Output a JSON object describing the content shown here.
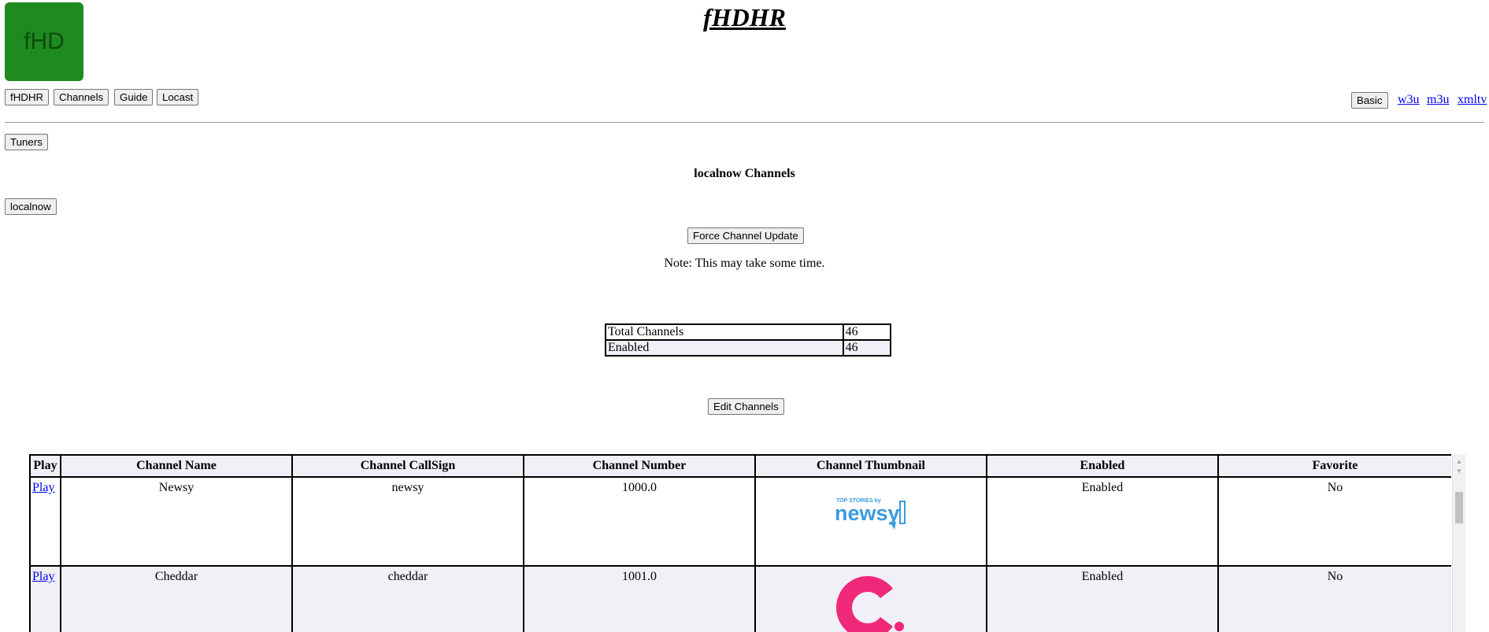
{
  "header": {
    "logo_text": "fHD",
    "title": "fHDHR"
  },
  "nav": {
    "left_buttons": [
      "fHDHR",
      "Channels",
      "Guide",
      "Locast"
    ],
    "basic_button": "Basic",
    "links": [
      "w3u",
      "m3u",
      "xmltv"
    ]
  },
  "tuners_button": "Tuners",
  "section_title": "localnow Channels",
  "origin_button": "localnow",
  "force_update_button": "Force Channel Update",
  "note": "Note: This may take some time.",
  "summary": [
    {
      "label": "Total Channels",
      "value": "46"
    },
    {
      "label": "Enabled",
      "value": "46"
    }
  ],
  "edit_button": "Edit Channels",
  "channels_table": {
    "headers": [
      "Play",
      "Channel Name",
      "Channel CallSign",
      "Channel Number",
      "Channel Thumbnail",
      "Enabled",
      "Favorite"
    ],
    "rows": [
      {
        "play": "Play",
        "name": "Newsy",
        "callsign": "newsy",
        "number": "1000.0",
        "thumbnail": "newsy-logo",
        "enabled": "Enabled",
        "favorite": "No"
      },
      {
        "play": "Play",
        "name": "Cheddar",
        "callsign": "cheddar",
        "number": "1001.0",
        "thumbnail": "cheddar-logo",
        "enabled": "Enabled",
        "favorite": "No"
      }
    ],
    "thumb_text": {
      "newsy_small": "TOP STORIES by",
      "newsy_main": "newsy"
    }
  },
  "colors": {
    "logo_green": "#1f8a1f",
    "newsy_blue": "#3a9be0",
    "cheddar_pink": "#f0287a",
    "alt_row": "#f0f0f6",
    "link": "#0000ee"
  }
}
